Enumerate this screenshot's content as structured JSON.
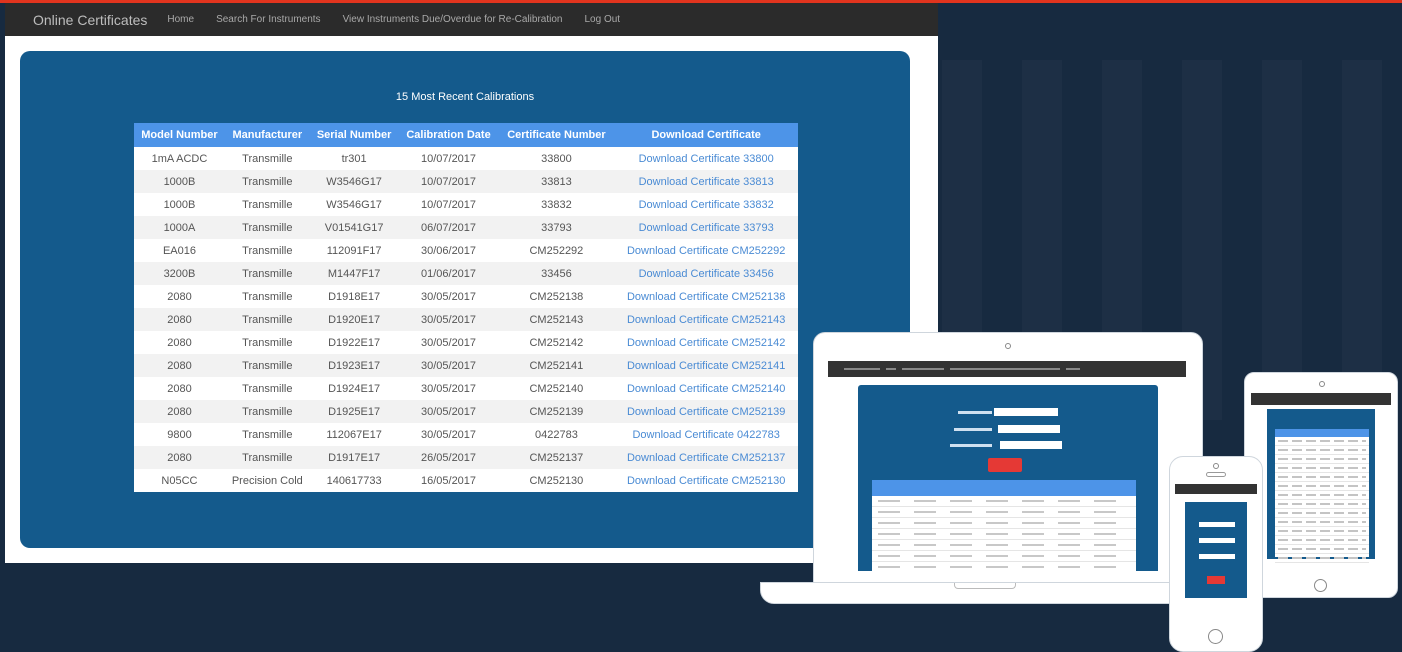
{
  "nav": {
    "brand": "Online Certificates",
    "links": [
      "Home",
      "Search For Instruments",
      "View Instruments Due/Overdue for Re-Calibration",
      "Log Out"
    ]
  },
  "panel": {
    "title": "15 Most Recent Calibrations"
  },
  "table": {
    "headers": [
      "Model Number",
      "Manufacturer",
      "Serial Number",
      "Calibration Date",
      "Certificate Number",
      "Download Certificate"
    ],
    "rows": [
      [
        "1mA ACDC",
        "Transmille",
        "tr301",
        "10/07/2017",
        "33800",
        "Download Certificate 33800"
      ],
      [
        "1000B",
        "Transmille",
        "W3546G17",
        "10/07/2017",
        "33813",
        "Download Certificate 33813"
      ],
      [
        "1000B",
        "Transmille",
        "W3546G17",
        "10/07/2017",
        "33832",
        "Download Certificate 33832"
      ],
      [
        "1000A",
        "Transmille",
        "V01541G17",
        "06/07/2017",
        "33793",
        "Download Certificate 33793"
      ],
      [
        "EA016",
        "Transmille",
        "112091F17",
        "30/06/2017",
        "CM252292",
        "Download Certificate CM252292"
      ],
      [
        "3200B",
        "Transmille",
        "M1447F17",
        "01/06/2017",
        "33456",
        "Download Certificate 33456"
      ],
      [
        "2080",
        "Transmille",
        "D1918E17",
        "30/05/2017",
        "CM252138",
        "Download Certificate CM252138"
      ],
      [
        "2080",
        "Transmille",
        "D1920E17",
        "30/05/2017",
        "CM252143",
        "Download Certificate CM252143"
      ],
      [
        "2080",
        "Transmille",
        "D1922E17",
        "30/05/2017",
        "CM252142",
        "Download Certificate CM252142"
      ],
      [
        "2080",
        "Transmille",
        "D1923E17",
        "30/05/2017",
        "CM252141",
        "Download Certificate CM252141"
      ],
      [
        "2080",
        "Transmille",
        "D1924E17",
        "30/05/2017",
        "CM252140",
        "Download Certificate CM252140"
      ],
      [
        "2080",
        "Transmille",
        "D1925E17",
        "30/05/2017",
        "CM252139",
        "Download Certificate CM252139"
      ],
      [
        "9800",
        "Transmille",
        "112067E17",
        "30/05/2017",
        "0422783",
        "Download Certificate 0422783"
      ],
      [
        "2080",
        "Transmille",
        "D1917E17",
        "26/05/2017",
        "CM252137",
        "Download Certificate CM252137"
      ],
      [
        "N05CC",
        "Precision Cold",
        "140617733",
        "16/05/2017",
        "CM252130",
        "Download Certificate CM252130"
      ]
    ]
  },
  "colors": {
    "background": "#172a40",
    "accent_bar": "#e1341e",
    "panel": "#145a8c",
    "table_header": "#4d94e8",
    "link": "#4a8bd4",
    "search_button": "#e53935"
  }
}
